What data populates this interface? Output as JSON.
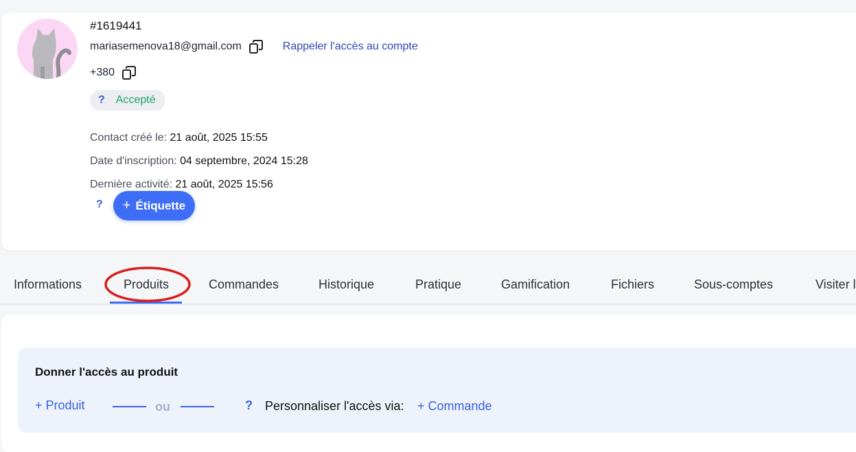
{
  "contact": {
    "id": "#1619441",
    "email": "mariasemenova18@gmail.com",
    "recall_link": "Rappeler l'accès au compte",
    "phone": "+380",
    "status": {
      "help": "?",
      "label": "Accepté"
    },
    "meta": [
      {
        "key": "Contact créé le:",
        "value": "21 août, 2025 15:55"
      },
      {
        "key": "Date d'inscription:",
        "value": "04 septembre, 2024 15:28"
      },
      {
        "key": "Dernière activité:",
        "value": "21 août, 2025 15:56"
      }
    ],
    "tag_help": "?",
    "tag_button": {
      "plus": "+",
      "label": "Étiquette"
    }
  },
  "tabs": [
    {
      "label": "Informations"
    },
    {
      "label": "Produits"
    },
    {
      "label": "Commandes"
    },
    {
      "label": "Historique"
    },
    {
      "label": "Pratique"
    },
    {
      "label": "Gamification"
    },
    {
      "label": "Fichiers"
    },
    {
      "label": "Sous-comptes"
    },
    {
      "label": "Visiter l"
    }
  ],
  "active_tab": "Produits",
  "access": {
    "title": "Donner l'accès au produit",
    "add_product": "+ Produit",
    "or_label": "ou",
    "help": "?",
    "personalize_label": "Personnaliser l'accès via:",
    "add_order": "+ Commande"
  },
  "colors": {
    "accent_blue": "#3f6ef6",
    "link_blue": "#2f47b8",
    "status_green": "#21a36a",
    "avatar_bg": "#fbd7f5",
    "annotation_red": "#d81e1e"
  },
  "icons": {
    "copy": "copy-icon",
    "avatar": "cat-silhouette"
  }
}
